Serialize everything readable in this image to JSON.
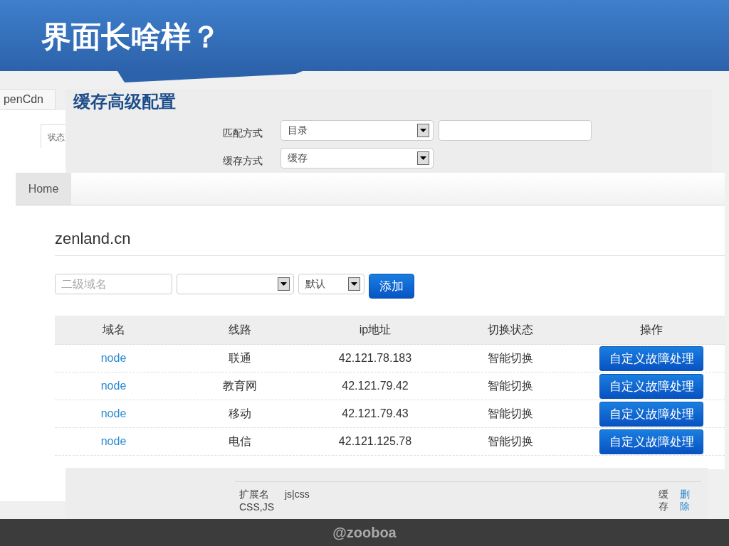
{
  "slide": {
    "title": "界面长啥样？",
    "footer": "@zooboa"
  },
  "back_screen": {
    "tab": "penCdn",
    "subtab": "状态"
  },
  "cache_config": {
    "title": "缓存高级配置",
    "rows": [
      {
        "label": "匹配方式",
        "fields": [
          {
            "kind": "select",
            "value": "目录"
          },
          {
            "kind": "input"
          }
        ]
      },
      {
        "label": "缓存方式",
        "fields": [
          {
            "kind": "select",
            "value": "缓存"
          }
        ]
      }
    ]
  },
  "domain_page": {
    "nav": [
      {
        "label": "Home",
        "selected": true
      }
    ],
    "heading": "zenland.cn",
    "form": [
      {
        "kind": "input",
        "placeholder": "二级域名"
      },
      {
        "kind": "select"
      },
      {
        "kind": "select",
        "value": "默认"
      },
      {
        "kind": "button",
        "label": "添加"
      }
    ],
    "table": {
      "columns": [
        "域名",
        "线路",
        "ip地址",
        "切换状态",
        "操作"
      ],
      "rows": [
        {
          "name": "node",
          "line": "联通",
          "ip": "42.121.78.183",
          "status": "智能切换",
          "action": "自定义故障处理"
        },
        {
          "name": "node",
          "line": "教育网",
          "ip": "42.121.79.42",
          "status": "智能切换",
          "action": "自定义故障处理"
        },
        {
          "name": "node",
          "line": "移动",
          "ip": "42.121.79.43",
          "status": "智能切换",
          "action": "自定义故障处理"
        },
        {
          "name": "node",
          "line": "电信",
          "ip": "42.121.125.78",
          "status": "智能切换",
          "action": "自定义故障处理"
        }
      ]
    }
  },
  "ext_rule": {
    "label": "扩展名",
    "value": "js|css",
    "note": "CSS,JS",
    "type": "缓存",
    "action": "删除"
  }
}
